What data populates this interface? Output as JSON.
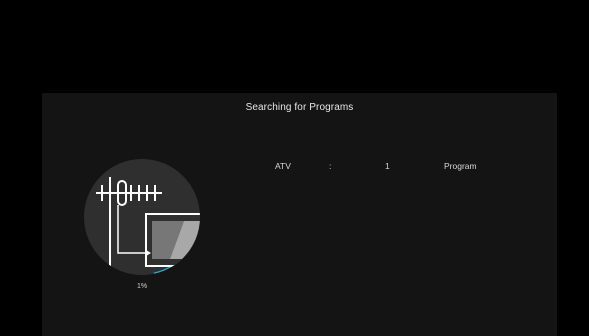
{
  "dialog": {
    "title": "Searching for Programs"
  },
  "scan_result": {
    "type": "ATV",
    "separator": ":",
    "count": "1",
    "unit": "Program"
  },
  "progress": {
    "label": "1%",
    "value_percent": 1
  },
  "colors": {
    "background": "#000000",
    "panel": "#141414",
    "accent": "#2aa7d8"
  },
  "icons": {
    "scan": "antenna-tv-icon"
  }
}
